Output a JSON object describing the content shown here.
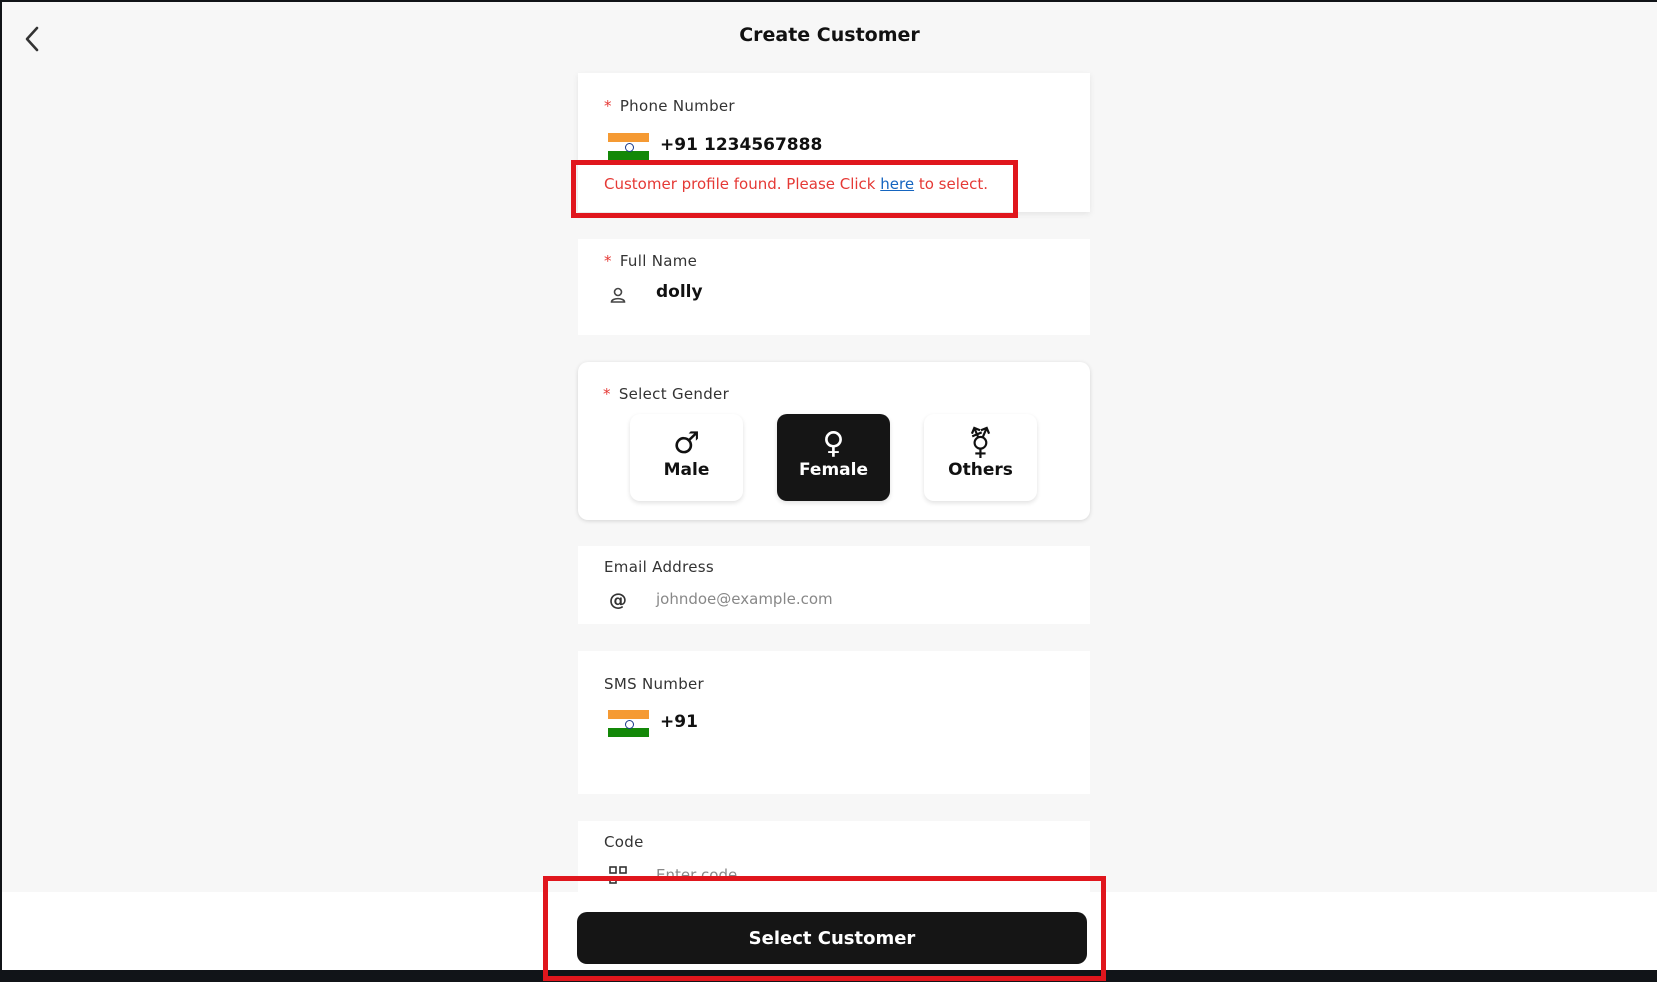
{
  "header": {
    "title": "Create Customer"
  },
  "phone": {
    "label": "Phone Number",
    "required_mark": "*",
    "dial_code": "+91",
    "value": "1234567888",
    "notice_prefix": "Customer profile found. Please Click ",
    "notice_link": "here",
    "notice_suffix": " to select."
  },
  "full_name": {
    "label": "Full Name",
    "required_mark": "*",
    "value": "dolly"
  },
  "gender": {
    "label": "Select Gender",
    "required_mark": "*",
    "options": [
      {
        "label": "Male",
        "icon": "♂"
      },
      {
        "label": "Female",
        "icon": "♀"
      },
      {
        "label": "Others",
        "icon": "⚧"
      }
    ],
    "selected": "Female"
  },
  "email": {
    "label": "Email Address",
    "placeholder": "johndoe@example.com"
  },
  "sms": {
    "label": "SMS Number",
    "dial_code": "+91"
  },
  "code": {
    "label": "Code",
    "placeholder": "Enter code"
  },
  "footer": {
    "select_button": "Select Customer"
  },
  "colors": {
    "accent": "#151515",
    "error": "#e53935",
    "highlight": "#e0161d",
    "link": "#1565c0"
  }
}
